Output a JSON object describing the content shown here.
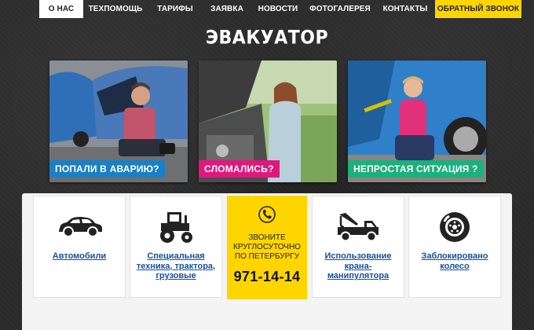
{
  "nav": {
    "items": [
      {
        "label": "О НАС",
        "active": true
      },
      {
        "label": "ТЕХПОМОЩЬ"
      },
      {
        "label": "ТАРИФЫ"
      },
      {
        "label": "ЗАЯВКА"
      },
      {
        "label": "НОВОСТИ"
      },
      {
        "label": "ФОТОГАЛЕРЕЯ"
      },
      {
        "label": "КОНТАКТЫ"
      }
    ],
    "cta_label": "ОБРАТНЫЙ ЗВОНОК"
  },
  "title": "ЭВАКУАТОР",
  "cards": [
    {
      "label": "ПОПАЛИ В АВАРИЮ?",
      "color": "#1b7fc4"
    },
    {
      "label": "СЛОМАЛИСЬ?",
      "color": "#e0177d"
    },
    {
      "label": "НЕПРОСТАЯ СИТУАЦИЯ ?",
      "color": "#1bb07d"
    }
  ],
  "services": [
    {
      "label": "Автомобили",
      "icon": "car-icon"
    },
    {
      "label": "Специальная\nтехника, трактора,\nгрузовые",
      "icon": "tractor-icon"
    },
    {
      "label": "Использование\nкрана-\nманипулятора",
      "icon": "tow-truck-icon"
    },
    {
      "label": "Заблокировано\nколесо",
      "icon": "wheel-icon"
    }
  ],
  "call": {
    "text": "ЗВОНИТЕ\nКРУГЛОСУТОЧНО\nПО ПЕТЕРБУРГУ",
    "phone": "971-14-14",
    "icon": "phone-icon"
  },
  "colors": {
    "accent": "#ffd500",
    "link": "#1a4f9a",
    "background": "#2b2b2b"
  }
}
